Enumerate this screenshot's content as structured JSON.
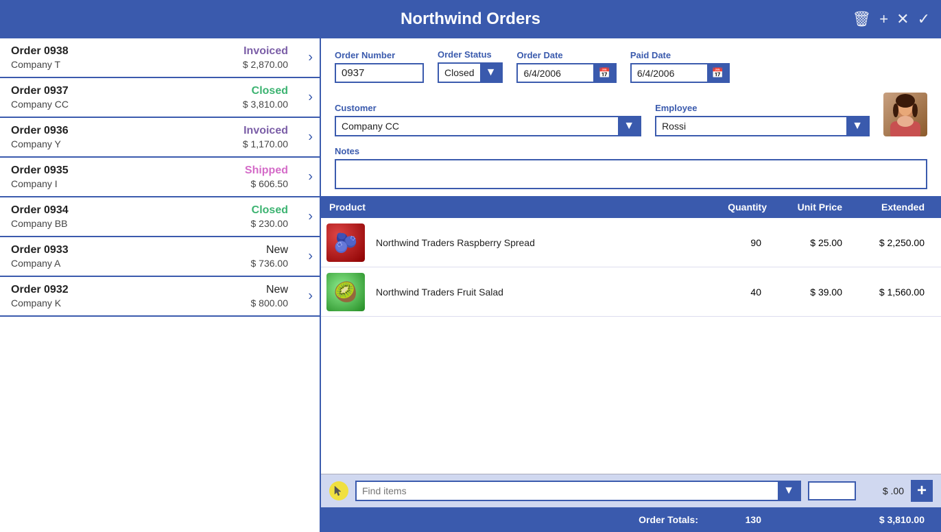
{
  "header": {
    "title": "Northwind Orders",
    "icons": {
      "delete": "🗑",
      "add": "+",
      "close": "✕",
      "check": "✓"
    }
  },
  "orders": [
    {
      "id": "0938",
      "status": "Invoiced",
      "status_type": "invoiced",
      "company": "Company T",
      "amount": "$ 2,870.00"
    },
    {
      "id": "0937",
      "status": "Closed",
      "status_type": "closed",
      "company": "Company CC",
      "amount": "$ 3,810.00"
    },
    {
      "id": "0936",
      "status": "Invoiced",
      "status_type": "invoiced",
      "company": "Company Y",
      "amount": "$ 1,170.00"
    },
    {
      "id": "0935",
      "status": "Shipped",
      "status_type": "shipped",
      "company": "Company I",
      "amount": "$ 606.50"
    },
    {
      "id": "0934",
      "status": "Closed",
      "status_type": "closed",
      "company": "Company BB",
      "amount": "$ 230.00"
    },
    {
      "id": "0933",
      "status": "New",
      "status_type": "new",
      "company": "Company A",
      "amount": "$ 736.00"
    },
    {
      "id": "0932",
      "status": "New",
      "status_type": "new",
      "company": "Company K",
      "amount": "$ 800.00"
    }
  ],
  "detail": {
    "order_number_label": "Order Number",
    "order_number_value": "0937",
    "order_status_label": "Order Status",
    "order_status_value": "Closed",
    "order_date_label": "Order Date",
    "order_date_value": "6/4/2006",
    "paid_date_label": "Paid Date",
    "paid_date_value": "6/4/2006",
    "customer_label": "Customer",
    "customer_value": "Company CC",
    "employee_label": "Employee",
    "employee_value": "Rossi",
    "notes_label": "Notes",
    "notes_value": ""
  },
  "products_table": {
    "col_product": "Product",
    "col_quantity": "Quantity",
    "col_unit_price": "Unit Price",
    "col_extended": "Extended",
    "items": [
      {
        "name": "Northwind Traders Raspberry Spread",
        "quantity": "90",
        "unit_price": "$ 25.00",
        "extended": "$ 2,250.00",
        "img_type": "raspberry"
      },
      {
        "name": "Northwind Traders Fruit Salad",
        "quantity": "40",
        "unit_price": "$ 39.00",
        "extended": "$ 1,560.00",
        "img_type": "fruitsalad"
      }
    ]
  },
  "add_item": {
    "placeholder": "Find items",
    "qty_value": "",
    "price": "$ .00"
  },
  "totals": {
    "label": "Order Totals:",
    "quantity": "130",
    "extended": "$ 3,810.00"
  }
}
